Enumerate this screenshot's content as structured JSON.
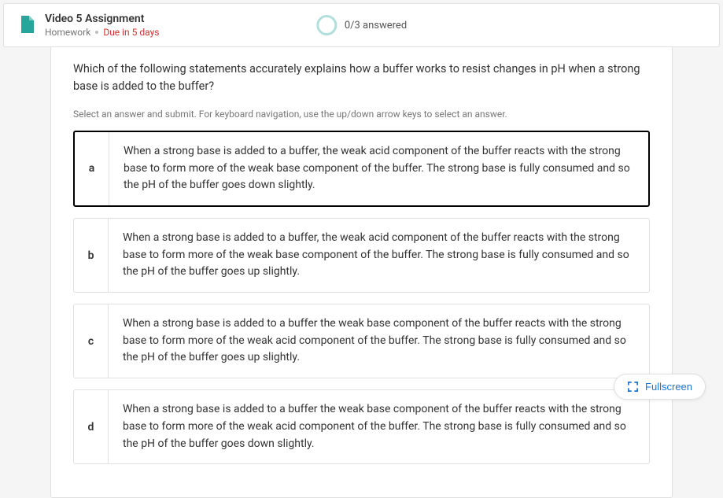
{
  "header": {
    "title": "Video 5 Assignment",
    "type": "Homework",
    "due": "Due in 5 days",
    "progress": "0/3 answered"
  },
  "question": {
    "prompt": "Which of the following statements accurately explains how a buffer works to resist changes in pH when a strong base is added to the buffer?",
    "instructions": "Select an answer and submit. For keyboard navigation, use the up/down arrow keys to select an answer.",
    "choices": [
      {
        "letter": "a",
        "text": "When a strong base is added to a buffer, the weak acid component of the buffer reacts with the strong base to form more of the weak base component of the buffer. The strong base is fully consumed and so the pH of the buffer goes down slightly."
      },
      {
        "letter": "b",
        "text": "When a strong base is added to a buffer, the weak acid component of the buffer reacts with the strong base to form more of the weak base component of the buffer. The strong base is fully consumed and so the pH of the buffer goes up slightly."
      },
      {
        "letter": "c",
        "text": "When a strong base is added to a buffer the weak base component of the buffer reacts with the strong base to form more of the weak acid component of the buffer. The strong base is fully consumed and so the pH of the buffer goes up slightly."
      },
      {
        "letter": "d",
        "text": "When a strong base is added to a buffer the weak base component of the buffer reacts with the strong base to form more of the weak acid component of the buffer. The strong base is fully consumed and so the pH of the buffer goes down slightly."
      }
    ],
    "selected_index": 0
  },
  "controls": {
    "fullscreen": "Fullscreen"
  }
}
